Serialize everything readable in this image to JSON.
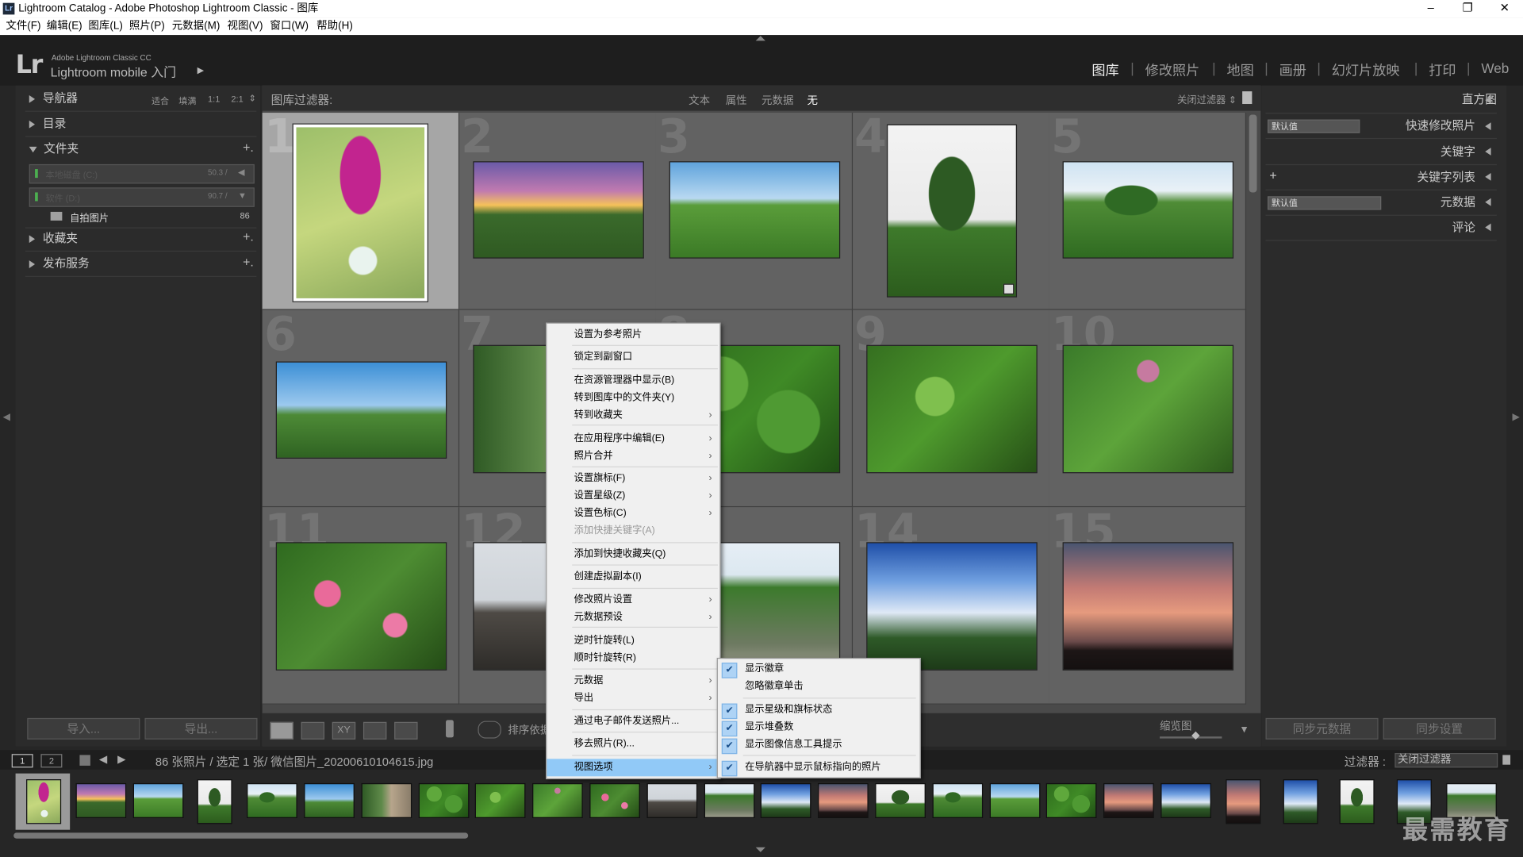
{
  "window": {
    "title": "Lightroom Catalog - Adobe Photoshop Lightroom Classic - 图库",
    "logo": "Lr",
    "controls": [
      "–",
      "❐",
      "✕"
    ]
  },
  "menubar": [
    "文件(F)",
    "编辑(E)",
    "图库(L)",
    "照片(P)",
    "元数据(M)",
    "视图(V)",
    "窗口(W)",
    "帮助(H)"
  ],
  "identity": {
    "logo": "Lr",
    "small": "Adobe Lightroom Classic CC",
    "big": "Lightroom mobile 入门",
    "arrow": "▶"
  },
  "modules": [
    "图库",
    "修改照片",
    "地图",
    "画册",
    "幻灯片放映",
    "打印",
    "Web"
  ],
  "module_separator": "|",
  "left_panel": {
    "navigator": {
      "label": "导航器",
      "options": [
        "适合",
        "填满",
        "1:1",
        "2:1"
      ],
      "more": "⇕"
    },
    "catalog": "目录",
    "folders": {
      "label": "文件夹",
      "add": "+."
    },
    "volumes": [
      {
        "name": "本地磁盘 (C:)",
        "value": "50.3 /",
        "arrow": "◀"
      },
      {
        "name": "软件 (D:)",
        "value": "90.7 /",
        "arrow": "▼"
      }
    ],
    "folder_item": {
      "name": "自拍图片",
      "count": "86"
    },
    "collections": {
      "label": "收藏夹",
      "add": "+."
    },
    "publish": {
      "label": "发布服务",
      "add": "+."
    },
    "import_button": "导入...",
    "export_button": "导出..."
  },
  "filter_bar": {
    "label": "图库过滤器:",
    "tabs": [
      "文本",
      "属性",
      "元数据",
      "无"
    ],
    "active_tab": "无",
    "preset": "关闭过滤器 ⇕",
    "lock_icon": "lock-icon"
  },
  "grid": {
    "cells": [
      {
        "num": "1",
        "photo": "p-flower",
        "selected": true
      },
      {
        "num": "2",
        "photo": "p-sunset"
      },
      {
        "num": "3",
        "photo": "p-field"
      },
      {
        "num": "4",
        "photo": "p-tree",
        "badge": true
      },
      {
        "num": "5",
        "photo": "p-hills"
      },
      {
        "num": "6",
        "photo": "p-house"
      },
      {
        "num": "7",
        "photo": "p-wall"
      },
      {
        "num": "8",
        "photo": "p-leaves"
      },
      {
        "num": "9",
        "photo": "p-bush"
      },
      {
        "num": "10",
        "photo": "p-pinkleaf"
      },
      {
        "num": "11",
        "photo": "p-azalea"
      },
      {
        "num": "12",
        "photo": "p-building"
      },
      {
        "num": "13",
        "photo": "p-trees2"
      },
      {
        "num": "14",
        "photo": "p-sky"
      },
      {
        "num": "15",
        "photo": "p-dusk"
      }
    ]
  },
  "toolbar": {
    "sort_label": "排序依据",
    "thumb_label": "缩览图",
    "xy": "XY",
    "painter_icon": "spray-can-icon",
    "chevron": "▾"
  },
  "right_panel": {
    "histogram": "直方图",
    "quick_develop": {
      "preset": "默认值",
      "label": "快速修改照片"
    },
    "keywording": "关键字",
    "keyword_list": {
      "add": "+",
      "label": "关键字列表"
    },
    "metadata": {
      "preset": "默认值",
      "label": "元数据"
    },
    "comments": "评论",
    "sync_metadata": "同步元数据",
    "sync_settings": "同步设置"
  },
  "filmstrip_bar": {
    "screen1": "1",
    "screen2": "2",
    "nav_back": "◀",
    "nav_forward": "▶",
    "info": "86 张照片 / 选定 1 张/ 微信图片_20200610104615.jpg",
    "filter_label": "过滤器 :",
    "filter_value": "关闭过滤器"
  },
  "context_menu": {
    "items": [
      {
        "label": "设置为参考照片"
      },
      {
        "label": "锁定到副窗口"
      },
      {
        "label": "在资源管理器中显示(B)"
      },
      {
        "label": "转到图库中的文件夹(Y)"
      },
      {
        "label": "转到收藏夹",
        "sub": true
      },
      {
        "label": "在应用程序中编辑(E)",
        "sub": true
      },
      {
        "label": "照片合并",
        "sub": true
      },
      {
        "label": "设置旗标(F)",
        "sub": true
      },
      {
        "label": "设置星级(Z)",
        "sub": true
      },
      {
        "label": "设置色标(C)",
        "sub": true
      },
      {
        "label": "添加快捷关键字(A)",
        "disabled": true
      },
      {
        "label": "添加到快捷收藏夹(Q)"
      },
      {
        "label": "创建虚拟副本(I)"
      },
      {
        "label": "修改照片设置",
        "sub": true
      },
      {
        "label": "元数据预设",
        "sub": true
      },
      {
        "label": "逆时针旋转(L)"
      },
      {
        "label": "顺时针旋转(R)"
      },
      {
        "label": "元数据",
        "sub": true
      },
      {
        "label": "导出",
        "sub": true
      },
      {
        "label": "通过电子邮件发送照片..."
      },
      {
        "label": "移去照片(R)..."
      },
      {
        "label": "视图选项",
        "sub": true,
        "highlighted": true
      }
    ],
    "arrow": "›"
  },
  "submenu": {
    "items": [
      {
        "label": "显示徽章",
        "checked": true
      },
      {
        "label": "忽略徽章单击",
        "checked": false
      },
      {
        "label": "显示星级和旗标状态",
        "checked": true
      },
      {
        "label": "显示堆叠数",
        "checked": true
      },
      {
        "label": "显示图像信息工具提示",
        "checked": true
      },
      {
        "label": "在导航器中显示鼠标指向的照片",
        "checked": true
      }
    ],
    "check": "✔"
  },
  "watermark": "最需教育",
  "colors": {
    "panel": "#2b2b2b",
    "grid": "#4a4a4a",
    "cell": "#626262",
    "selected_cell": "#a6a6a6",
    "menu_highlight": "#91c9f7"
  }
}
